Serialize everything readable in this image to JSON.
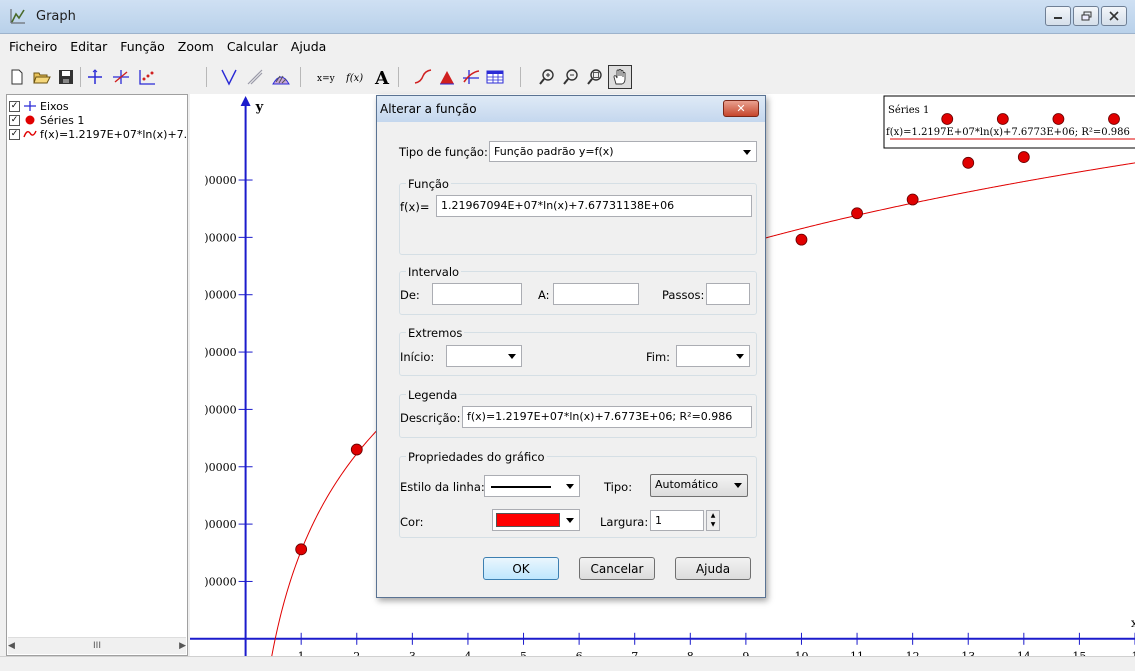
{
  "window": {
    "title": "Graph"
  },
  "menu": [
    "Ficheiro",
    "Editar",
    "Função",
    "Zoom",
    "Calcular",
    "Ajuda"
  ],
  "toolbar_icons": [
    "new-file-icon",
    "open-folder-icon",
    "save-icon",
    "axes-icon",
    "insert-function-icon",
    "insert-series-icon",
    "tangent-icon",
    "relation-icon",
    "shading-icon",
    "trendline-icon",
    "evaluate-icon",
    "text-label-icon",
    "insert-curve-icon",
    "area-icon",
    "point-series-icon",
    "table-icon",
    "zoom-in-icon",
    "zoom-out-icon",
    "zoom-window-icon",
    "hand-pan-icon"
  ],
  "left_panel": {
    "items": [
      {
        "label": "Eixos",
        "checked": true,
        "icon": "axes-icon"
      },
      {
        "label": "Séries 1",
        "checked": true,
        "icon": "red-dot-icon"
      },
      {
        "label": "f(x)=1.2197E+07*ln(x)+7.",
        "checked": true,
        "icon": "red-curve-icon"
      }
    ],
    "scroll_thumb": "III"
  },
  "graph": {
    "y_axis_label": "y",
    "x_axis_label": "x",
    "y_tick_labels": [
      ")0000",
      ")0000",
      ")0000",
      ")0000",
      ")0000",
      ")0000",
      ")0000",
      ")0000"
    ],
    "x_tick_labels": [
      "1",
      "2",
      "3",
      "4",
      "5",
      "6",
      "7",
      "8",
      "9",
      "10",
      "11",
      "12",
      "13",
      "14",
      "15",
      "1"
    ],
    "legend": {
      "title": "Séries 1",
      "entry": "f(x)=1.2197E+07*ln(x)+7.6773E+06; R²=0.986"
    },
    "colors": {
      "axes": "#1b1bcc",
      "series": "#e00000",
      "curve": "#e00000"
    }
  },
  "chart_data": {
    "type": "scatter",
    "series": [
      {
        "name": "Séries 1",
        "x": [
          1,
          2,
          10,
          11,
          12,
          13,
          14
        ],
        "y": [
          7800000.0,
          16500000.0,
          34800000.0,
          37100000.0,
          38300000.0,
          41500000.0,
          42000000.0
        ]
      },
      {
        "name": "f(x)=1.2197E+07*ln(x)+7.6773E+06; R²=0.986",
        "function": {
          "a": 12196709.4,
          "b": 7677311.38
        }
      }
    ],
    "legend_points_x": [
      13,
      14,
      15,
      16
    ],
    "xlim": [
      -1,
      16
    ],
    "ylim": [
      -1500000,
      47500000
    ]
  },
  "dialog": {
    "title": "Alterar a função",
    "function_type_label": "Tipo de função:",
    "function_type_value": "Função padrão  y=f(x)",
    "function_group": "Função",
    "fx_label": "f(x)=",
    "fx_value": "1.21967094E+07*ln(x)+7.67731138E+06",
    "interval_group": "Intervalo",
    "from_label": "De:",
    "to_label": "A:",
    "steps_label": "Passos:",
    "extremes_group": "Extremos",
    "start_label": "Início:",
    "end_label": "Fim:",
    "legend_group": "Legenda",
    "description_label": "Descrição:",
    "description_value": "f(x)=1.2197E+07*ln(x)+7.6773E+06; R²=0.986",
    "props_group": "Propriedades do gráfico",
    "line_style_label": "Estilo da linha:",
    "type_label": "Tipo:",
    "type_value": "Automático",
    "color_label": "Cor:",
    "color_value": "#ff0000",
    "width_label": "Largura:",
    "width_value": "1",
    "ok": "OK",
    "cancel": "Cancelar",
    "help": "Ajuda"
  }
}
